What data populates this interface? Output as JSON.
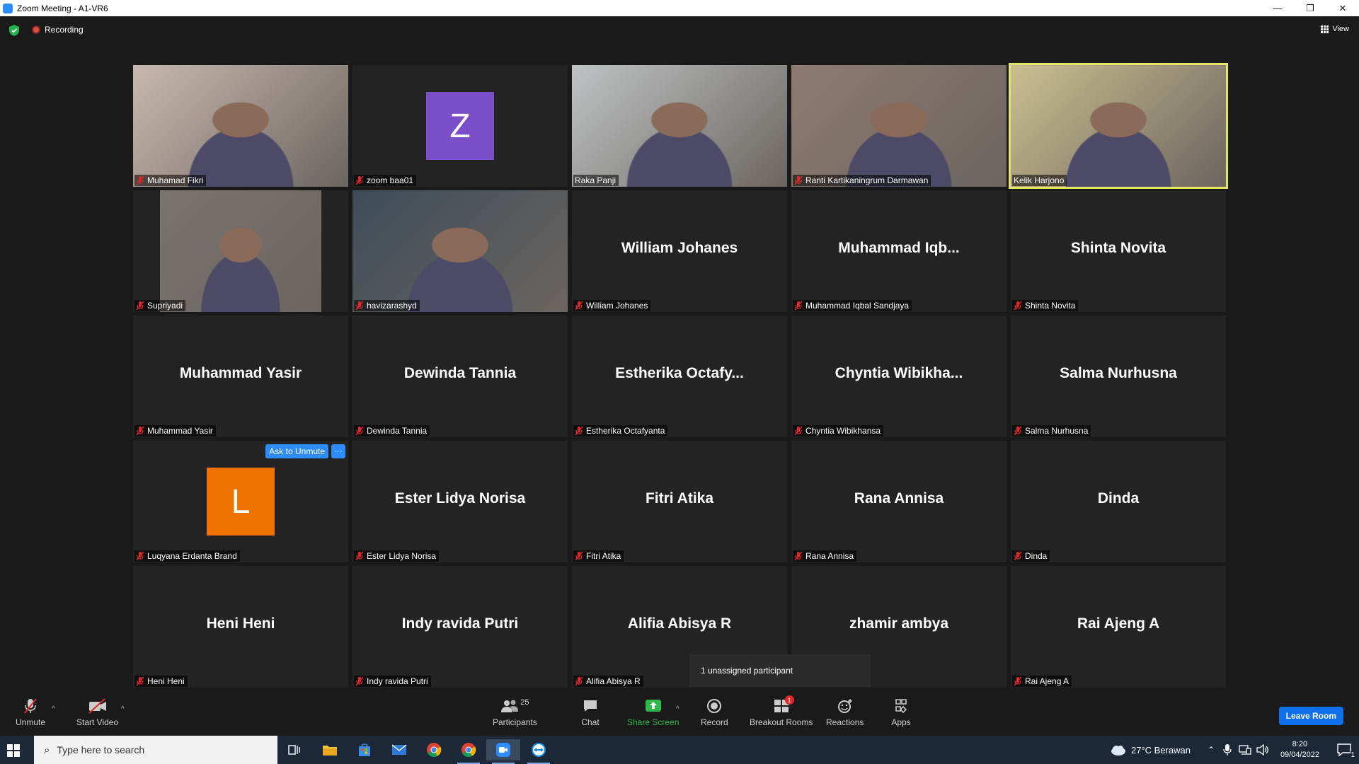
{
  "window": {
    "title": "Zoom Meeting - A1-VR6",
    "minimize": "—",
    "restore": "❐",
    "close": "✕"
  },
  "topbar": {
    "recording": "Recording",
    "view": "View"
  },
  "tiles": [
    {
      "label": "Muhamad Fikri",
      "kind": "video",
      "bg": "#c9b8ae"
    },
    {
      "label": "zoom baa01",
      "kind": "avatar",
      "avatar": "Z",
      "avatar_color": "#7b4fc9"
    },
    {
      "label": "Raka Panji",
      "kind": "video",
      "bg": "#bfc3c4"
    },
    {
      "label": "Ranti Kartikaningrum Darmawan",
      "kind": "video",
      "bg": "#8f7b70"
    },
    {
      "label": "Kelik Harjono",
      "kind": "video",
      "bg": "#cbbf8f",
      "active": true
    },
    {
      "label": "Supriyadi",
      "kind": "video",
      "bg": "#7a7470",
      "narrow": true
    },
    {
      "label": "havizarashyd",
      "kind": "video",
      "bg": "#3e4c58"
    },
    {
      "label": "William Johanes",
      "kind": "name",
      "name": "William Johanes"
    },
    {
      "label": "Muhammad Iqbal Sandjaya",
      "kind": "name",
      "name": "Muhammad  Iqb..."
    },
    {
      "label": "Shinta Novita",
      "kind": "name",
      "name": "Shinta Novita"
    },
    {
      "label": "Muhammad Yasir",
      "kind": "name",
      "name": "Muhammad Yasir"
    },
    {
      "label": "Dewinda Tannia",
      "kind": "name",
      "name": "Dewinda Tannia"
    },
    {
      "label": "Estherika Octafyanta",
      "kind": "name",
      "name": "Estherika  Octafy..."
    },
    {
      "label": "Chyntia Wibikhansa",
      "kind": "name",
      "name": "Chyntia  Wibikha..."
    },
    {
      "label": "Salma Nurhusna",
      "kind": "name",
      "name": "Salma Nurhusna"
    },
    {
      "label": "Luqyana Erdanta Brand",
      "kind": "avatar",
      "avatar": "L",
      "avatar_color": "#f07200",
      "ask": "Ask to Unmute",
      "more": "···"
    },
    {
      "label": "Ester Lidya Norisa",
      "kind": "name",
      "name": "Ester Lidya Norisa"
    },
    {
      "label": "Fitri Atika",
      "kind": "name",
      "name": "Fitri Atika"
    },
    {
      "label": "Rana Annisa",
      "kind": "name",
      "name": "Rana Annisa"
    },
    {
      "label": "Dinda",
      "kind": "name",
      "name": "Dinda"
    },
    {
      "label": "Heni Heni",
      "kind": "name",
      "name": "Heni Heni"
    },
    {
      "label": "Indy ravida Putri",
      "kind": "name",
      "name": "Indy ravida Putri"
    },
    {
      "label": "Alifia Abisya R",
      "kind": "name",
      "name": "Alifia Abisya R"
    },
    {
      "label": "zhamir ambya",
      "kind": "name",
      "name": "zhamir ambya",
      "nolabel": true
    },
    {
      "label": "Rai Ajeng A",
      "kind": "name",
      "name": "Rai Ajeng A"
    }
  ],
  "tooltip": "1 unassigned participant",
  "toolbar": {
    "unmute": "Unmute",
    "start_video": "Start Video",
    "participants": "Participants",
    "participants_count": "25",
    "chat": "Chat",
    "share_screen": "Share Screen",
    "record": "Record",
    "breakout_rooms": "Breakout Rooms",
    "breakout_badge": "1",
    "reactions": "Reactions",
    "apps": "Apps",
    "leave": "Leave Room"
  },
  "taskbar": {
    "search_placeholder": "Type here to search",
    "weather": "27°C  Berawan",
    "time": "8:20",
    "date": "09/04/2022",
    "notif_count": "1"
  },
  "colors": {
    "accent": "#2d8cff",
    "active_border": "#e4e36a",
    "share_green": "#2fb94c",
    "mute_red": "#e02828"
  }
}
